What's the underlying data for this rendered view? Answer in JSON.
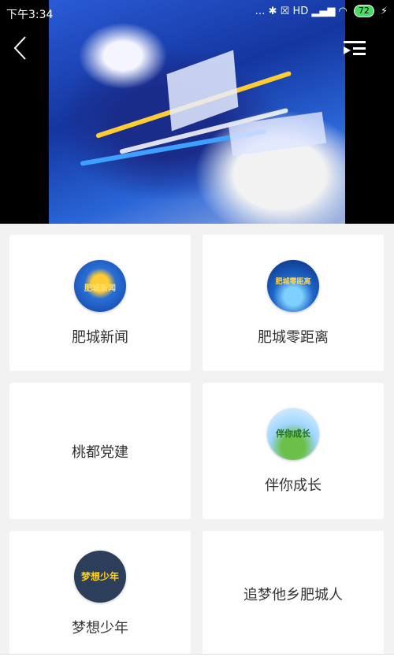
{
  "status_bar": {
    "time": "下午3:34",
    "indicators": "… ✱ ☒ HD ▂▄▆ ◠",
    "battery": "72"
  },
  "video": {
    "back_icon": "chevron-left-icon",
    "playlist_icon": "playlist-icon"
  },
  "cards": [
    {
      "label": "肥城新闻",
      "logo_text": "肥城新闻"
    },
    {
      "label": "肥城零距离",
      "logo_text": "肥城零距离"
    },
    {
      "label": "桃都党建"
    },
    {
      "label": "伴你成长",
      "logo_text": "伴你成长"
    },
    {
      "label": "梦想少年",
      "logo_text": "梦想少年"
    },
    {
      "label": "追梦他乡肥城人"
    }
  ]
}
